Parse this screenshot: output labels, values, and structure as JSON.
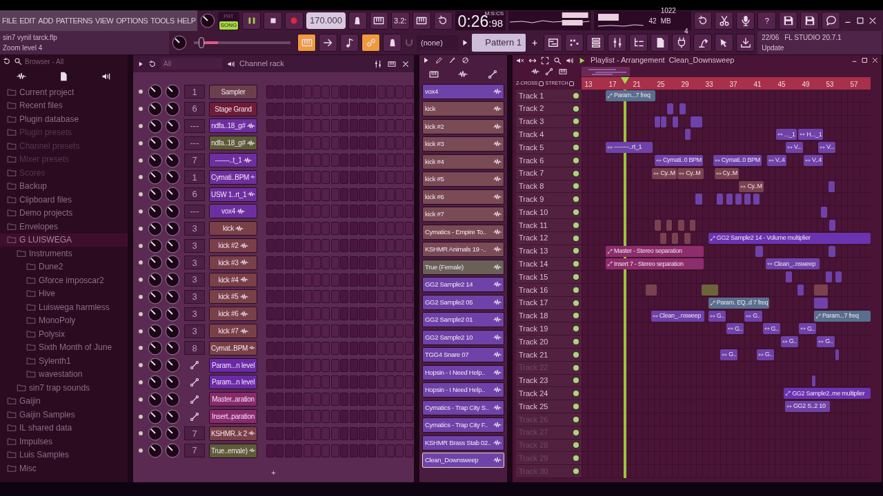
{
  "menu": [
    "FILE",
    "EDIT",
    "ADD",
    "PATTERNS",
    "VIEW",
    "OPTIONS",
    "TOOLS",
    "HELP"
  ],
  "transport": {
    "modes": [
      {
        "label": "PAT",
        "selected": false
      },
      {
        "label": "SONG",
        "selected": true
      }
    ],
    "tempo": "170.000",
    "time": {
      "main": "0:26",
      "fraction": ":98",
      "unit": "M:S:CS"
    }
  },
  "countdown_label": "3.2:",
  "monitor": {
    "cpu": "42",
    "memory": "1022 MB",
    "voices": "4"
  },
  "help_label": "?",
  "project": {
    "file": "sin7 vynil tarck.flp",
    "hint": "Zoom level 4"
  },
  "pitch_slider": {
    "level": 0.05
  },
  "tools": [
    {
      "kind": "typing",
      "on": true
    },
    {
      "kind": "arrow",
      "on": false
    },
    {
      "kind": "note",
      "on": false
    },
    {
      "kind": "link",
      "on": true
    },
    {
      "kind": "bell",
      "on": false
    }
  ],
  "snap": "(none)",
  "pattern": {
    "name": "Pattern 1",
    "add": "+"
  },
  "news": {
    "date": "22/06",
    "title": "FL STUDIO 20.7.1",
    "action": "Update"
  },
  "browser": {
    "title": "Browser - All",
    "items": [
      {
        "label": "Current project",
        "dimmed": false,
        "selected": false
      },
      {
        "label": "Recent files",
        "dimmed": false,
        "selected": false
      },
      {
        "label": "Plugin database",
        "dimmed": false,
        "selected": false
      },
      {
        "label": "Plugin presets",
        "dimmed": true,
        "selected": false
      },
      {
        "label": "Channel presets",
        "dimmed": true,
        "selected": false
      },
      {
        "label": "Mixer presets",
        "dimmed": true,
        "selected": false
      },
      {
        "label": "Scores",
        "dimmed": true,
        "selected": false
      },
      {
        "label": "Backup",
        "dimmed": false,
        "selected": false
      },
      {
        "label": "Clipboard files",
        "dimmed": false,
        "selected": false
      },
      {
        "label": "Demo projects",
        "dimmed": false,
        "selected": false
      },
      {
        "label": "Envelopes",
        "dimmed": false,
        "selected": false
      },
      {
        "label": "G LUISWEGA",
        "dimmed": false,
        "selected": true,
        "children": [
          {
            "label": "Instruments",
            "dimmed": false,
            "selected": false,
            "children": [
              {
                "label": "Dune2",
                "dimmed": false,
                "selected": false
              },
              {
                "label": "Gforce imposcar2",
                "dimmed": false,
                "selected": false
              },
              {
                "label": "Hive",
                "dimmed": false,
                "selected": false
              },
              {
                "label": "Luiswega harmless",
                "dimmed": false,
                "selected": false
              },
              {
                "label": "MonoPoly",
                "dimmed": false,
                "selected": false
              },
              {
                "label": "Polysix",
                "dimmed": false,
                "selected": false
              },
              {
                "label": "Sixth Month of June",
                "dimmed": false,
                "selected": false
              },
              {
                "label": "Sylenth1",
                "dimmed": false,
                "selected": false
              },
              {
                "label": "wavestation",
                "dimmed": false,
                "selected": false
              }
            ]
          },
          {
            "label": "sin7 trap sounds",
            "dimmed": false,
            "selected": false
          }
        ]
      },
      {
        "label": "Gaijin",
        "dimmed": false,
        "selected": false
      },
      {
        "label": "Gaijin Samples",
        "dimmed": false,
        "selected": false
      },
      {
        "label": "IL shared data",
        "dimmed": false,
        "selected": false
      },
      {
        "label": "Impulses",
        "dimmed": false,
        "selected": false
      },
      {
        "label": "Luis Samples",
        "dimmed": false,
        "selected": false
      },
      {
        "label": "Misc",
        "dimmed": false,
        "selected": false
      }
    ]
  },
  "channel_rack": {
    "filter": "All",
    "title": "Channel rack",
    "add": "+",
    "channels": [
      {
        "mixer": "1",
        "name": "Sampler",
        "kind": "instrument",
        "color": "#6b3f4c"
      },
      {
        "mixer": "6",
        "name": "Stage Grand",
        "kind": "instrument",
        "color": "#6e1d38"
      },
      {
        "mixer": "---",
        "name": "ndfa..18_g#",
        "kind": "audio",
        "color": "#6d2fa0"
      },
      {
        "mixer": "---",
        "name": "ndfa..18_g#",
        "kind": "audio",
        "color": "#5e5c38"
      },
      {
        "mixer": "7",
        "name": "-------..t_1",
        "kind": "audio",
        "color": "#6d2fa0"
      },
      {
        "mixer": "1",
        "name": "Cymati..BPM",
        "kind": "audio",
        "color": "#6d2fa0"
      },
      {
        "mixer": "6",
        "name": "USW 1..rt_1",
        "kind": "audio",
        "color": "#6d2fa0"
      },
      {
        "mixer": "---",
        "name": "vox4",
        "kind": "audio",
        "color": "#6d2fa0"
      },
      {
        "mixer": "3",
        "name": "kick",
        "kind": "audio",
        "color": "#7a4048"
      },
      {
        "mixer": "3",
        "name": "kick #2",
        "kind": "audio",
        "color": "#7a4048"
      },
      {
        "mixer": "3",
        "name": "kick #3",
        "kind": "audio",
        "color": "#7a4048"
      },
      {
        "mixer": "3",
        "name": "kick #4",
        "kind": "audio",
        "color": "#7a4048"
      },
      {
        "mixer": "3",
        "name": "kick #5",
        "kind": "audio",
        "color": "#7a4048"
      },
      {
        "mixer": "3",
        "name": "kick #6",
        "kind": "audio",
        "color": "#7a4048"
      },
      {
        "mixer": "3",
        "name": "kick #7",
        "kind": "audio",
        "color": "#7a4048"
      },
      {
        "mixer": "8",
        "name": "Cymat..BPM",
        "kind": "audio",
        "color": "#7a4048"
      },
      {
        "name": "Param...n level",
        "kind": "automation",
        "color": "#6a2aa8"
      },
      {
        "name": "Param...n level",
        "kind": "automation",
        "color": "#6a2aa8"
      },
      {
        "name": "Master..aration",
        "kind": "automation",
        "color": "#8a2a6e"
      },
      {
        "name": "Insert..paration",
        "kind": "automation",
        "color": "#8a2a6e"
      },
      {
        "mixer": "7",
        "name": "KSHMR..k 2",
        "kind": "audio",
        "color": "#7a4048"
      },
      {
        "mixer": "7",
        "name": "True..emale)",
        "kind": "audio",
        "color": "#5e5c38"
      }
    ]
  },
  "picker": {
    "items": [
      {
        "name": "vox4",
        "color": "#6e42a8",
        "selected": false
      },
      {
        "name": "kick",
        "color": "#7a4a55",
        "selected": false
      },
      {
        "name": "kick #2",
        "color": "#7a4a55",
        "selected": false
      },
      {
        "name": "kick #3",
        "color": "#7a4a55",
        "selected": false
      },
      {
        "name": "kick #4",
        "color": "#7a4a55",
        "selected": false
      },
      {
        "name": "kick #5",
        "color": "#7a4a55",
        "selected": false
      },
      {
        "name": "kick #6",
        "color": "#7a4a55",
        "selected": false
      },
      {
        "name": "kick #7",
        "color": "#7a4a55",
        "selected": false
      },
      {
        "name": "Cymatics - Empire To..",
        "color": "#7a4a55",
        "selected": false
      },
      {
        "name": "KSHMR Animals 19 -..",
        "color": "#7a4a55",
        "selected": false
      },
      {
        "name": "True (Female)",
        "color": "#6a6058",
        "selected": false
      },
      {
        "name": "GG2 Sample2 14",
        "color": "#6e42a8",
        "selected": false
      },
      {
        "name": "GG2 Sample2 05",
        "color": "#6e42a8",
        "selected": false
      },
      {
        "name": "GG2 Sample2 01",
        "color": "#6e42a8",
        "selected": false
      },
      {
        "name": "GG2 Sample2 10",
        "color": "#6e42a8",
        "selected": false
      },
      {
        "name": "TGG4 Snare 07",
        "color": "#6e42a8",
        "selected": false
      },
      {
        "name": "Hopsin - I Need Help..",
        "color": "#6e42a8",
        "selected": false
      },
      {
        "name": "Hopsin - I Need Help..",
        "color": "#6e42a8",
        "selected": false
      },
      {
        "name": "Cymatics - Trap City S..",
        "color": "#6e42a8",
        "selected": false
      },
      {
        "name": "Cymatics - Trap City F..",
        "color": "#6e42a8",
        "selected": false
      },
      {
        "name": "KSHMR Brass Stab 02..",
        "color": "#6e42a8",
        "selected": false
      },
      {
        "name": "Clean_Downsweep",
        "color": "#6e42a8",
        "selected": true
      }
    ]
  },
  "playlist": {
    "title": "Playlist - Arrangement",
    "pattern": "Clean_Downsweep",
    "options": [
      {
        "label": "Z-CROSS",
        "checked": false
      },
      {
        "label": "STRETCH",
        "checked": false
      }
    ],
    "ruler": [
      "13",
      "17",
      "21",
      "25",
      "29",
      "33",
      "37",
      "41",
      "45",
      "49",
      "53",
      "57"
    ],
    "playhead": {
      "level": 0.145
    },
    "tracks": [
      {
        "name": "Track 1",
        "dimmed": false,
        "clips": [
          {
            "kind": "automation",
            "color": "#5a6f8e",
            "label": "Param...7 freq"
          }
        ]
      },
      {
        "name": "Track 2",
        "dimmed": false,
        "clips": [
          {
            "kind": "audio",
            "color": "#6e42a8"
          },
          {
            "kind": "audio",
            "color": "#6e42a8"
          }
        ]
      },
      {
        "name": "Track 3",
        "dimmed": false,
        "clips": [
          {
            "kind": "audio",
            "color": "#6e42a8"
          },
          {
            "kind": "audio",
            "color": "#6e42a8"
          },
          {
            "kind": "audio",
            "color": "#6e42a8"
          },
          {
            "kind": "audio",
            "color": "#6e42a8"
          }
        ]
      },
      {
        "name": "Track 4",
        "dimmed": false,
        "clips": [
          {
            "kind": "audio",
            "color": "#6e42a8"
          },
          {
            "kind": "audio",
            "color": "#6e42a8",
            "label": "..._1"
          },
          {
            "kind": "audio",
            "color": "#6e42a8",
            "label": "H..._1"
          }
        ]
      },
      {
        "name": "Track 5",
        "dimmed": false,
        "clips": [
          {
            "kind": "audio",
            "color": "#6e42a8",
            "label": "--------..rt_1"
          },
          {
            "kind": "audio",
            "color": "#6e42a8",
            "label": "V..."
          },
          {
            "kind": "audio",
            "color": "#6e42a8",
            "label": "V..."
          }
        ]
      },
      {
        "name": "Track 6",
        "dimmed": false,
        "clips": [
          {
            "kind": "audio",
            "color": "#6e42a8",
            "label": "Cymati..0 BPM"
          },
          {
            "kind": "audio",
            "color": "#6e42a8",
            "label": "Cymati..0 BPM"
          },
          {
            "kind": "audio",
            "color": "#6e42a8",
            "label": "V..4"
          },
          {
            "kind": "audio",
            "color": "#6e42a8",
            "label": "V..4"
          }
        ]
      },
      {
        "name": "Track 7",
        "dimmed": false,
        "clips": [
          {
            "kind": "audio",
            "color": "#7a4250",
            "label": "Cy..M"
          },
          {
            "kind": "audio",
            "color": "#7a4250",
            "label": "Cy..M"
          },
          {
            "kind": "audio",
            "color": "#7a4250",
            "label": "Cy..M"
          }
        ]
      },
      {
        "name": "Track 8",
        "dimmed": false,
        "clips": [
          {
            "kind": "audio",
            "color": "#7a4250",
            "label": "Cy..M"
          },
          {
            "kind": "audio",
            "color": "#6e42a8"
          }
        ]
      },
      {
        "name": "Track 9",
        "dimmed": false,
        "clips": [
          {
            "kind": "audio",
            "color": "#6e42a8"
          },
          {
            "kind": "audio",
            "color": "#6e42a8"
          },
          {
            "kind": "audio",
            "color": "#6e42a8"
          },
          {
            "kind": "audio",
            "color": "#6e42a8"
          },
          {
            "kind": "audio",
            "color": "#6e42a8"
          },
          {
            "kind": "audio",
            "color": "#6e42a8"
          }
        ]
      },
      {
        "name": "Track 10",
        "dimmed": false,
        "clips": [
          {
            "kind": "audio",
            "color": "#6e42a8"
          }
        ]
      },
      {
        "name": "Track 11",
        "dimmed": false,
        "clips": [
          {
            "kind": "audio",
            "color": "#7a4250"
          },
          {
            "kind": "audio",
            "color": "#7a4250"
          },
          {
            "kind": "audio",
            "color": "#7a4250"
          },
          {
            "kind": "audio",
            "color": "#7a4250"
          },
          {
            "kind": "audio",
            "color": "#6e42a8"
          }
        ]
      },
      {
        "name": "Track 12",
        "dimmed": false,
        "clips": [
          {
            "kind": "audio",
            "color": "#7a4250"
          },
          {
            "kind": "audio",
            "color": "#7a4250"
          },
          {
            "kind": "audio",
            "color": "#7a4250"
          },
          {
            "kind": "automation",
            "color": "#6a33b0",
            "label": "GG2 Sample2 14 - Volume multiplier"
          }
        ]
      },
      {
        "name": "Track 13",
        "dimmed": false,
        "clips": [
          {
            "kind": "automation",
            "color": "#8e2d6c",
            "label": "Master - Stereo separation"
          },
          {
            "kind": "audio",
            "color": "#6e42a8"
          },
          {
            "kind": "audio",
            "color": "#6e42a8"
          }
        ]
      },
      {
        "name": "Track 14",
        "dimmed": false,
        "clips": [
          {
            "kind": "automation",
            "color": "#8e2d6c",
            "label": "Insert 7 - Stereo separation"
          },
          {
            "kind": "audio",
            "color": "#6e42a8",
            "label": "Clean_..nsweep"
          }
        ]
      },
      {
        "name": "Track 15",
        "dimmed": false,
        "clips": [
          {
            "kind": "audio",
            "color": "#6e42a8"
          },
          {
            "kind": "audio",
            "color": "#6e42a8"
          },
          {
            "kind": "audio",
            "color": "#6e42a8"
          }
        ]
      },
      {
        "name": "Track 16",
        "dimmed": false,
        "clips": [
          {
            "kind": "audio",
            "color": "#7a4250"
          },
          {
            "kind": "audio",
            "color": "#6b6538"
          },
          {
            "kind": "audio",
            "color": "#6e42a8"
          },
          {
            "kind": "audio",
            "color": "#7a4250"
          }
        ]
      },
      {
        "name": "Track 17",
        "dimmed": false,
        "clips": [
          {
            "kind": "automation",
            "color": "#5a6f8e",
            "label": "Param. EQ..d 7 freq"
          },
          {
            "kind": "audio",
            "color": "#6e42a8"
          }
        ]
      },
      {
        "name": "Track 18",
        "dimmed": false,
        "clips": [
          {
            "kind": "audio",
            "color": "#6e42a8",
            "label": "Clean_..nsweep"
          },
          {
            "kind": "audio",
            "color": "#6e42a8",
            "label": "G.."
          },
          {
            "kind": "audio",
            "color": "#6e42a8",
            "label": "G.."
          },
          {
            "kind": "automation",
            "color": "#5a6f8e",
            "label": "Param...7 freq"
          }
        ]
      },
      {
        "name": "Track 19",
        "dimmed": false,
        "clips": [
          {
            "kind": "audio",
            "color": "#6e42a8",
            "label": "G.."
          },
          {
            "kind": "audio",
            "color": "#6e42a8",
            "label": "G.."
          },
          {
            "kind": "audio",
            "color": "#6e42a8",
            "label": "G.."
          }
        ]
      },
      {
        "name": "Track 20",
        "dimmed": false,
        "clips": [
          {
            "kind": "audio",
            "color": "#6e42a8",
            "label": "G.."
          },
          {
            "kind": "audio",
            "color": "#6e42a8",
            "label": "G.."
          }
        ]
      },
      {
        "name": "Track 21",
        "dimmed": false,
        "clips": [
          {
            "kind": "audio",
            "color": "#6e42a8",
            "label": "G.."
          },
          {
            "kind": "audio",
            "color": "#6e42a8",
            "label": "G.."
          },
          {
            "kind": "audio",
            "color": "#6e42a8"
          }
        ]
      },
      {
        "name": "Track 22",
        "dimmed": true
      },
      {
        "name": "Track 23",
        "dimmed": false,
        "clips": [
          {
            "kind": "audio",
            "color": "#6e42a8"
          }
        ]
      },
      {
        "name": "Track 24",
        "dimmed": false,
        "clips": [
          {
            "kind": "automation",
            "color": "#6a33b0",
            "label": "GG2 Sample2..me multiplier"
          }
        ]
      },
      {
        "name": "Track 25",
        "dimmed": false,
        "clips": [
          {
            "kind": "audio",
            "color": "#6e42a8",
            "label": "GG2 S..2 10"
          }
        ]
      },
      {
        "name": "Track 26",
        "dimmed": true
      },
      {
        "name": "Track 27",
        "dimmed": true
      },
      {
        "name": "Track 28",
        "dimmed": true
      },
      {
        "name": "Track 29",
        "dimmed": true
      },
      {
        "name": "Track 30",
        "dimmed": true
      }
    ]
  }
}
